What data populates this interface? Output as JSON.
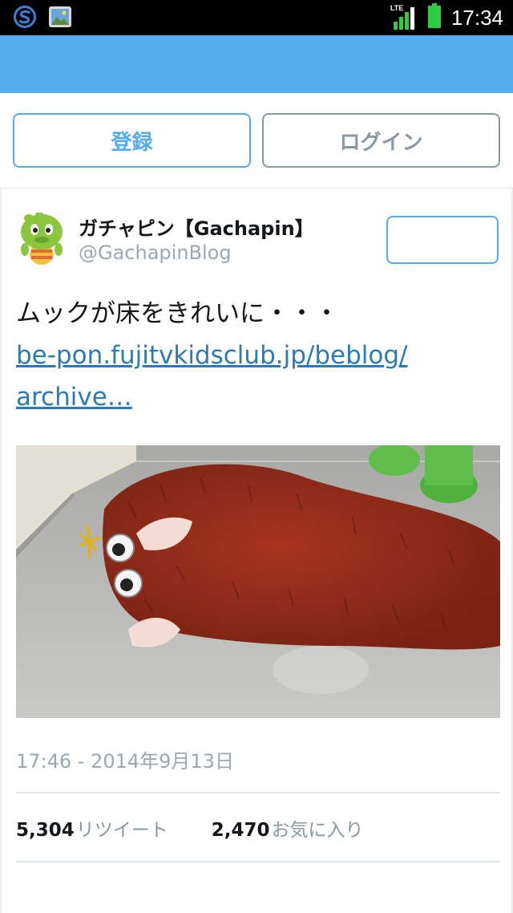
{
  "status_bar": {
    "time": "17:34",
    "network": "LTE",
    "icons": [
      "s-app-icon",
      "gallery-icon",
      "signal-icon",
      "battery-icon"
    ]
  },
  "colors": {
    "brand_blue": "#55acee",
    "link": "#2b7bb9",
    "muted": "#8899a6"
  },
  "auth": {
    "signup_label": "登録",
    "login_label": "ログイン"
  },
  "tweet": {
    "author_name": "ガチャピン【Gachapin】",
    "author_handle": "@GachapinBlog",
    "text": "ムックが床をきれいに・・・",
    "link_line1": "be-pon.fujitvkidsclub.jp/beblog/",
    "link_line2": "archive…",
    "timestamp": "17:46 - 2014年9月13日",
    "retweet_count": "5,304",
    "retweet_label": "リツイート",
    "favorite_count": "2,470",
    "favorite_label": "お気に入り"
  }
}
